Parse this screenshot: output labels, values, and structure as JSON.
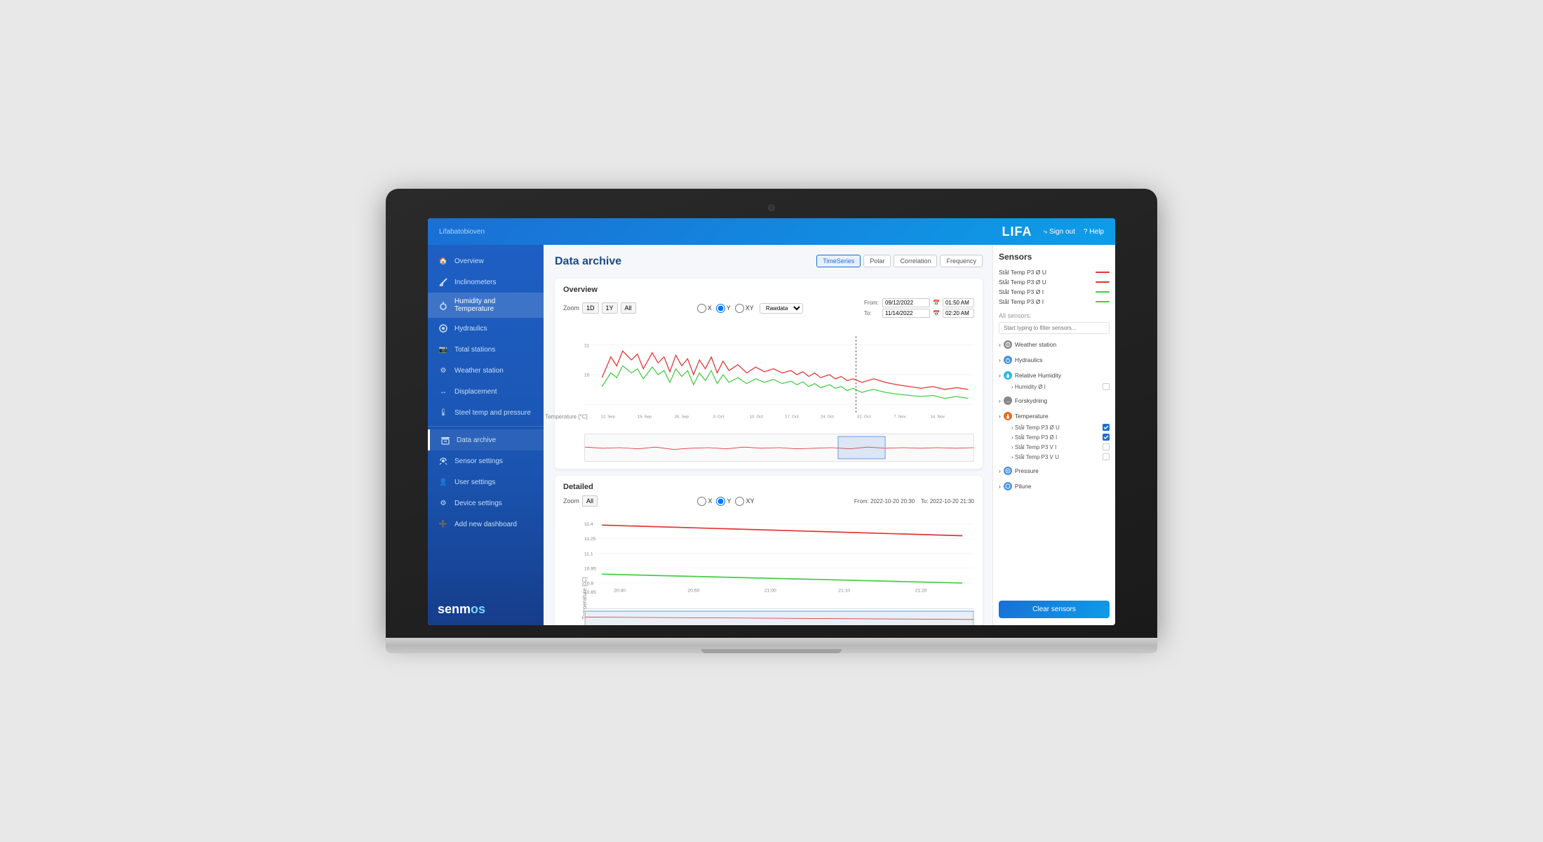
{
  "app": {
    "brand": "Lifabatobioven",
    "logo": "LIFA",
    "sign_out": "Sign out",
    "help": "Help"
  },
  "sidebar": {
    "items": [
      {
        "id": "overview",
        "label": "Overview",
        "icon": "home"
      },
      {
        "id": "inclinometers",
        "label": "Inclinometers",
        "icon": "incline"
      },
      {
        "id": "humidity-temp",
        "label": "Humidity and Temperature",
        "icon": "humidity"
      },
      {
        "id": "hydraulics",
        "label": "Hydraulics",
        "icon": "hydraulics"
      },
      {
        "id": "total-stations",
        "label": "Total stations",
        "icon": "station"
      },
      {
        "id": "weather-station",
        "label": "Weather station",
        "icon": "weather"
      },
      {
        "id": "displacement",
        "label": "Displacement",
        "icon": "displacement"
      },
      {
        "id": "steel-temp",
        "label": "Steel temp and pressure",
        "icon": "temp"
      }
    ],
    "bottom_items": [
      {
        "id": "data-archive",
        "label": "Data archive",
        "icon": "archive"
      },
      {
        "id": "sensor-settings",
        "label": "Sensor settings",
        "icon": "sensor"
      },
      {
        "id": "user-settings",
        "label": "User settings",
        "icon": "user"
      },
      {
        "id": "device-settings",
        "label": "Device settings",
        "icon": "device"
      },
      {
        "id": "add-dashboard",
        "label": "Add new dashboard",
        "icon": "add"
      }
    ],
    "logo_text": "senm",
    "logo_highlight": "os"
  },
  "page": {
    "title": "Data archive",
    "tabs": [
      "TimeSeries",
      "Polar",
      "Correlation",
      "Frequency"
    ]
  },
  "overview_chart": {
    "title": "Overview",
    "zoom_label": "Zoom",
    "zoom_options": [
      "1D",
      "1Y",
      "All"
    ],
    "axis_options": [
      "X",
      "Y",
      "XY"
    ],
    "dropdown": "Rawdata",
    "from_label": "From:",
    "to_label": "To:",
    "from_date": "09/12/2022",
    "from_time": "01:50 AM",
    "to_date": "11/14/2022",
    "to_time": "02:20 AM",
    "y_axis_label": "Temperature [°C]",
    "x_ticks": [
      "12. Sep",
      "19. Sep",
      "26. Sep",
      "3. Oct",
      "10. Oct",
      "17. Oct",
      "24. Oct",
      "31. Oct",
      "7. Nov",
      "14. Nov"
    ],
    "y_ticks": [
      "11",
      "10"
    ]
  },
  "detailed_chart": {
    "title": "Detailed",
    "zoom_label": "Zoom",
    "zoom_options": [
      "All"
    ],
    "axis_options": [
      "X",
      "Y",
      "XY"
    ],
    "from_datetime": "From: 2022-10-20 20:30",
    "to_datetime": "To: 2022-10-20 21:30",
    "y_axis_label": "Temperature [°C]",
    "x_ticks": [
      "20:40",
      "20:50",
      "21:00",
      "21:10",
      "21:20"
    ],
    "y_ticks": [
      "11.4",
      "11.25",
      "11.1",
      "10.95",
      "10.8",
      "10.65"
    ]
  },
  "sensors": {
    "title": "Sensors",
    "active_sensors": [
      {
        "label": "Stål Temp P3 Ø U",
        "color": "#e53333"
      },
      {
        "label": "Stål Temp P3 Ø U",
        "color": "#e53333"
      },
      {
        "label": "Stål Temp P3 Ø I",
        "color": "#44cc44"
      },
      {
        "label": "Stål Temp P3 Ø I",
        "color": "#44cc44"
      }
    ],
    "all_sensors_label": "All sensors:",
    "filter_placeholder": "Start typing to filter sensors...",
    "categories": [
      {
        "id": "weather",
        "label": "Weather station",
        "icon": "weather",
        "color": "#888",
        "items": [],
        "collapsed": true
      },
      {
        "id": "hydraulics",
        "label": "Hydraulics",
        "icon": "hydraulics",
        "color": "#4a90e2",
        "items": [],
        "collapsed": true
      },
      {
        "id": "relative-humidity",
        "label": "Relative Humidity",
        "icon": "humidity",
        "color": "#4a90e2",
        "items": [
          {
            "label": "Humidity Ø I",
            "checked": false
          }
        ],
        "collapsed": false
      },
      {
        "id": "forskydning",
        "label": "Forskydning",
        "icon": "displacement",
        "color": "#888",
        "items": [],
        "collapsed": true
      },
      {
        "id": "temperature",
        "label": "Temperature",
        "icon": "temp",
        "color": "#e86c1a",
        "items": [
          {
            "label": "Stål Temp P3 Ø U",
            "checked": true
          },
          {
            "label": "Stål Temp P3 Ø I",
            "checked": true
          },
          {
            "label": "Stål Temp P3 V I",
            "checked": false
          },
          {
            "label": "Stål Temp P3 V U",
            "checked": false
          }
        ],
        "collapsed": false
      },
      {
        "id": "pressure",
        "label": "Pressure",
        "icon": "pressure",
        "color": "#4a90e2",
        "items": [],
        "collapsed": true
      },
      {
        "id": "pilune",
        "label": "Pilune",
        "icon": "pilune",
        "color": "#4a90e2",
        "items": [],
        "collapsed": true
      }
    ],
    "clear_button": "Clear sensors"
  }
}
